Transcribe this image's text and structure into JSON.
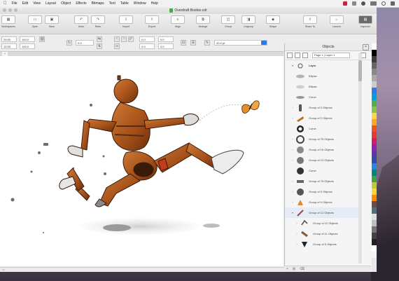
{
  "menubar": {
    "apple": "",
    "items": [
      "File",
      "Edit",
      "View",
      "Layout",
      "Object",
      "Effects",
      "Bitmaps",
      "Text",
      "Table",
      "Window",
      "Help"
    ]
  },
  "window": {
    "title": "Overdraft Boobie.cdr"
  },
  "toolbar": {
    "buttons": [
      {
        "label": "Workspaces",
        "icon": "grid-icon"
      },
      {
        "label": "Open",
        "icon": "folder-icon"
      },
      {
        "label": "Save",
        "icon": "save-icon"
      },
      {
        "label": "Undo",
        "icon": "undo-icon"
      },
      {
        "label": "Redo",
        "icon": "redo-icon"
      },
      {
        "label": "Import",
        "icon": "import-icon"
      },
      {
        "label": "Export",
        "icon": "export-icon"
      },
      {
        "label": "Align",
        "icon": "align-icon"
      },
      {
        "label": "Arrange",
        "icon": "arrange-icon"
      },
      {
        "label": "Group",
        "icon": "group-icon"
      },
      {
        "label": "Ungroup",
        "icon": "ungroup-icon"
      },
      {
        "label": "Shape",
        "icon": "shape-icon"
      },
      {
        "label": "Share To",
        "icon": "share-icon"
      },
      {
        "label": "Launch",
        "icon": "launch-icon"
      },
      {
        "label": "Inspector",
        "icon": "inspector-icon"
      }
    ]
  },
  "propbar": {
    "x": "29.50",
    "y": "12.50",
    "w": "100.0",
    "h": "100.0",
    "angle": "0.0",
    "outline": "0.0",
    "zoom": "Fit",
    "stroke": "20.0 pt"
  },
  "docker": {
    "title": "Objects",
    "page_label": "Page 1",
    "layer_label": "Layer 1",
    "layer_name": "Layer",
    "items": [
      "Ellipse",
      "Ellipse",
      "Curve",
      "Group of 3 Objects",
      "Group of 2 Objects",
      "Curve",
      "Group of 75 Objects",
      "Group of 16 Objects",
      "Group of 13 Objects",
      "Curve",
      "Group of 75 Objects",
      "Group of 5 Objects",
      "Group of 9 Objects",
      "Group of 12 Objects",
      "Group of 12 Objects",
      "Group of 11 Objects",
      "Group of 5 Objects"
    ]
  },
  "colors": {
    "robot_body": "#b3591f",
    "robot_dark": "#5a2a10",
    "butterfly": "#e08a2a",
    "selection": "#2c7be5"
  }
}
